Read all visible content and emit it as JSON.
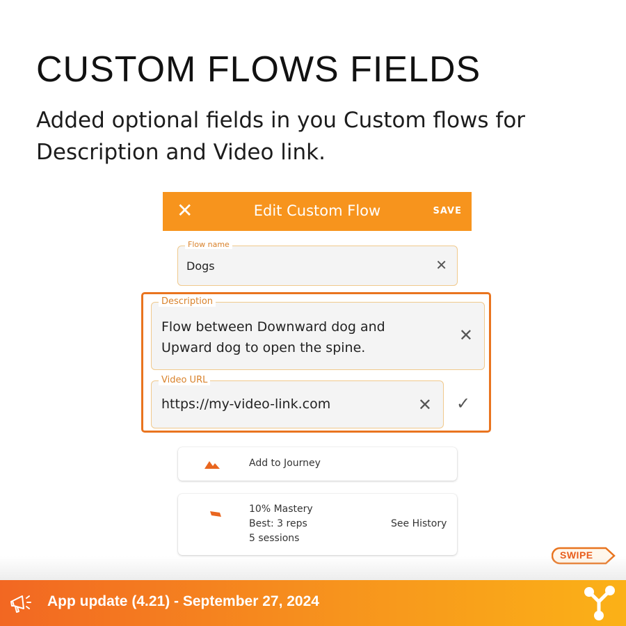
{
  "headline": "CUSTOM FLOWS FIELDS",
  "subtitle": "Added optional fields in you Custom flows for Description and Video link.",
  "app_bar": {
    "close_icon": "close-icon",
    "title": "Edit Custom Flow",
    "save_label": "SAVE",
    "color": "#f7941d"
  },
  "form": {
    "flow_name": {
      "label": "Flow name",
      "value": "Dogs"
    },
    "description": {
      "label": "Description",
      "value": "Flow between Downward dog and Upward dog to open the spine."
    },
    "video_url": {
      "label": "Video URL",
      "value": "https://my-video-link.com"
    },
    "highlight_color": "#e9741f"
  },
  "journey_card": {
    "icon": "mountain-icon",
    "label": "Add to Journey"
  },
  "mastery_card": {
    "icon": "flag-icon",
    "mastery": "10% Mastery",
    "best": "Best: 3 reps",
    "sessions": "5 sessions",
    "history_link": "See History"
  },
  "swipe_badge": "SWIPE",
  "footer": {
    "text": "App update (4.21) - September 27, 2024",
    "left_icon": "megaphone-icon",
    "right_icon": "share-nodes-icon"
  }
}
